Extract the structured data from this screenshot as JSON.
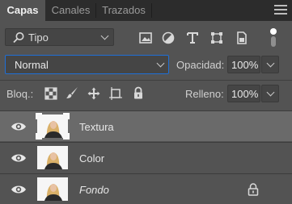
{
  "tabs": [
    {
      "label": "Capas",
      "active": true
    },
    {
      "label": "Canales",
      "active": false
    },
    {
      "label": "Trazados",
      "active": false
    }
  ],
  "filter": {
    "kind_label": "Tipo",
    "icons": [
      "image-filter-icon",
      "adjustment-filter-icon",
      "type-filter-icon",
      "shape-filter-icon",
      "smart-object-filter-icon"
    ]
  },
  "blend": {
    "mode": "Normal",
    "opacity_label": "Opacidad:",
    "opacity_value": "100%"
  },
  "lock": {
    "label": "Bloq.:",
    "icons": [
      "lock-transparent-pixels-icon",
      "lock-image-pixels-icon",
      "lock-position-icon",
      "lock-artboard-icon",
      "lock-all-icon"
    ],
    "fill_label": "Relleno:",
    "fill_value": "100%"
  },
  "layers": [
    {
      "name": "Textura",
      "selected": true,
      "italic": false,
      "locked": false
    },
    {
      "name": "Color",
      "selected": false,
      "italic": false,
      "locked": false
    },
    {
      "name": "Fondo",
      "selected": false,
      "italic": true,
      "locked": true
    }
  ],
  "colors": {
    "panel_bg": "#535353",
    "tabbar_bg": "#2c2c2c",
    "selected_row": "#6a6a6a",
    "focus_border": "#1f6fd6"
  }
}
